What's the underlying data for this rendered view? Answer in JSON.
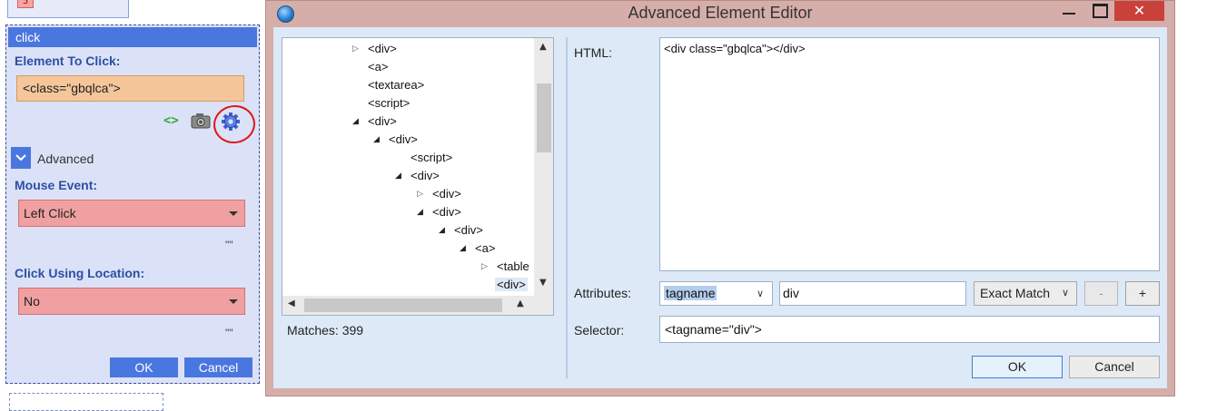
{
  "action_panel": {
    "prev_badge": "5",
    "title": "click",
    "element_label": "Element To Click:",
    "element_value": "<class=\"gbqlca\">",
    "advanced_label": "Advanced",
    "mouse_event_label": "Mouse Event:",
    "mouse_event_value": "Left Click",
    "mouse_event_quote": "\"\"",
    "click_location_label": "Click Using Location:",
    "click_location_value": "No",
    "click_location_quote": "\"\"",
    "ok_label": "OK",
    "cancel_label": "Cancel",
    "highlight_color": "#e01818"
  },
  "dialog": {
    "title": "Advanced Element Editor",
    "close_glyph": "✕",
    "tree": {
      "nodes": [
        {
          "label": "<div>",
          "arrow": "collapsed"
        },
        {
          "label": "<a>",
          "arrow": "none"
        },
        {
          "label": "<textarea>",
          "arrow": "none"
        },
        {
          "label": "<script>",
          "arrow": "none"
        },
        {
          "label": "<div>",
          "arrow": "expanded"
        },
        {
          "label": "<div>",
          "arrow": "expanded"
        },
        {
          "label": "<script>",
          "arrow": "none"
        },
        {
          "label": "<div>",
          "arrow": "expanded"
        },
        {
          "label": "<div>",
          "arrow": "collapsed"
        },
        {
          "label": "<div>",
          "arrow": "expanded"
        },
        {
          "label": "<div>",
          "arrow": "expanded"
        },
        {
          "label": "<a>",
          "arrow": "expanded"
        },
        {
          "label": "<table",
          "arrow": "collapsed"
        },
        {
          "label": "<div>",
          "arrow": "none",
          "selected": true
        }
      ]
    },
    "matches_label": "Matches: 399",
    "html_label": "HTML:",
    "html_value": "<div class=\"gbqlca\"></div>",
    "attributes_label": "Attributes:",
    "attribute_name": "tagname",
    "attribute_value": "div",
    "match_mode": "Exact Match",
    "minus_label": "-",
    "plus_label": "+",
    "selector_label": "Selector:",
    "selector_value": "<tagname=\"div\">",
    "ok_label": "OK",
    "cancel_label": "Cancel",
    "close_color": "#c9413a"
  }
}
